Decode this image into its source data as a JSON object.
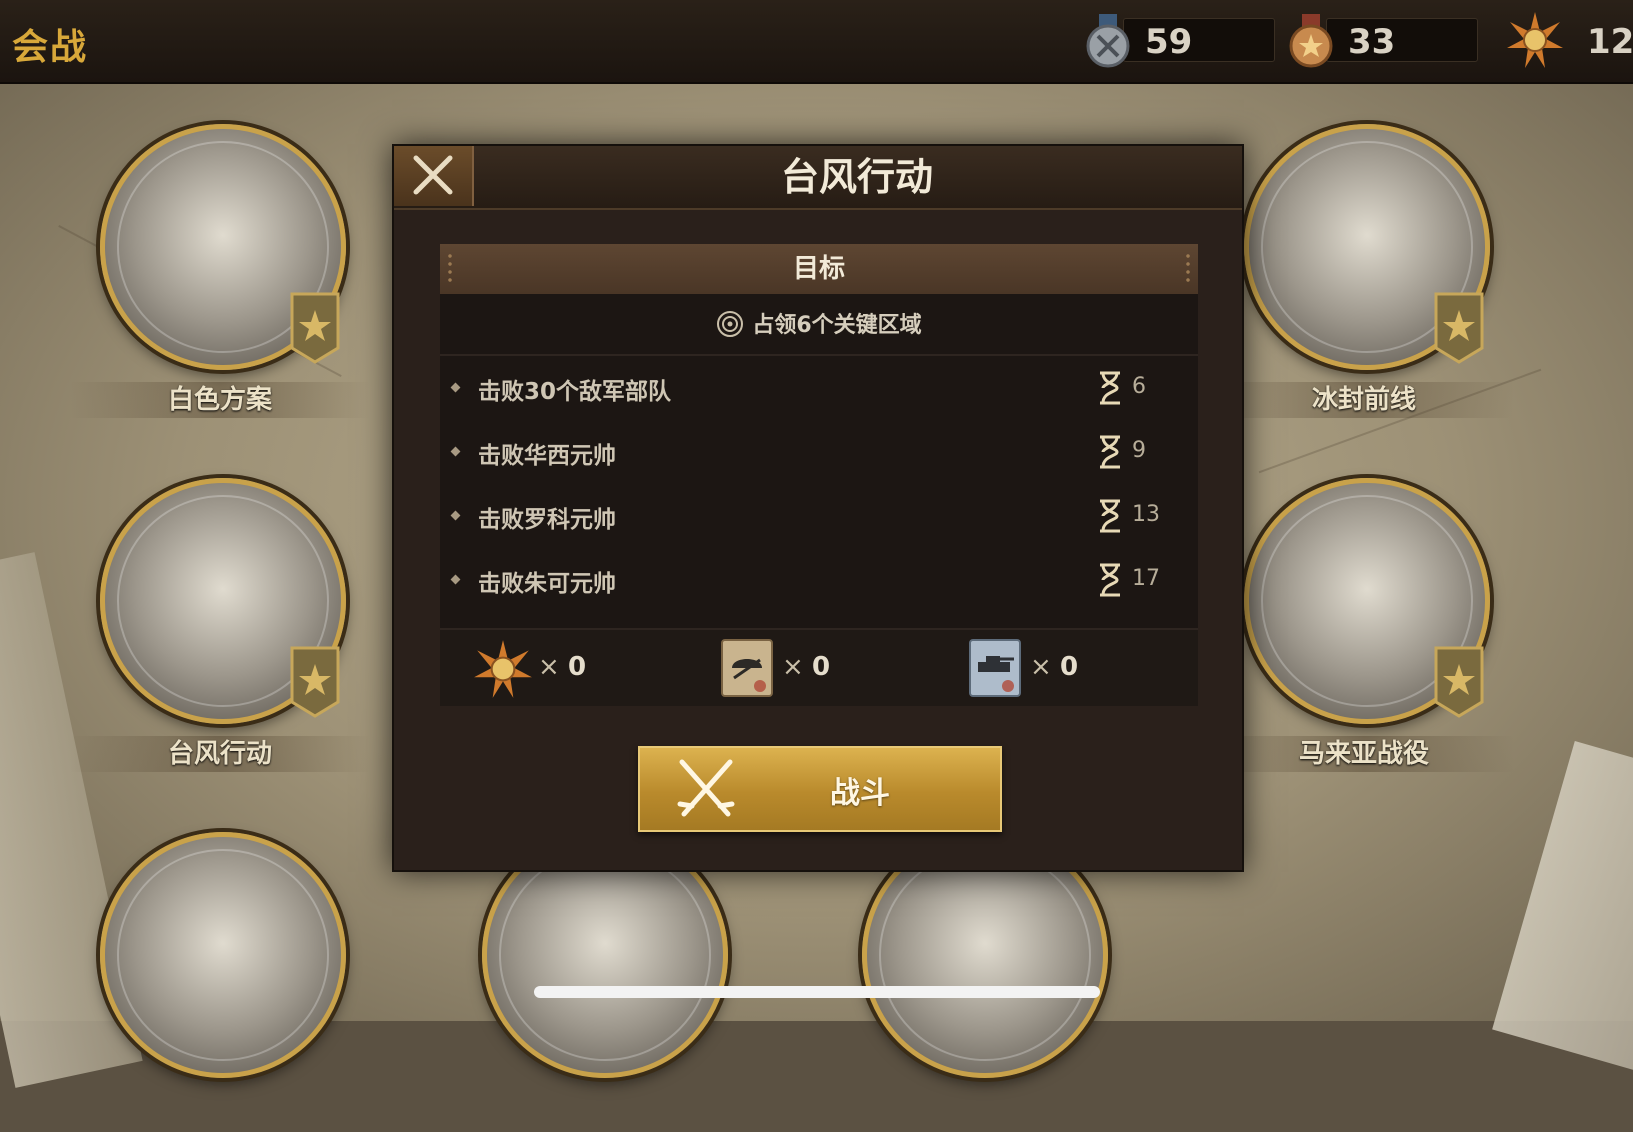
{
  "topbar": {
    "title": "会战",
    "resources": [
      {
        "icon": "silver-medal-icon",
        "value": "59"
      },
      {
        "icon": "bronze-medal-icon",
        "value": "33"
      },
      {
        "icon": "star-medal-icon",
        "value": "12"
      }
    ]
  },
  "campaigns": [
    {
      "label": "白色方案"
    },
    {
      "label": "冰封前线"
    },
    {
      "label": "台风行动"
    },
    {
      "label": "马来亚战役"
    }
  ],
  "modal": {
    "title": "台风行动",
    "goal_header": "目标",
    "primary_goal": "占领6个关键区域",
    "tasks": [
      {
        "text": "击败30个敌军部队",
        "turns": "6"
      },
      {
        "text": "击败华西元帅",
        "turns": "9"
      },
      {
        "text": "击败罗科元帅",
        "turns": "13"
      },
      {
        "text": "击败朱可元帅",
        "turns": "17"
      }
    ],
    "rewards": [
      {
        "icon": "star-medal-icon",
        "times": "×",
        "count": "0"
      },
      {
        "icon": "infantry-card-icon",
        "times": "×",
        "count": "0"
      },
      {
        "icon": "tank-card-icon",
        "times": "×",
        "count": "0"
      }
    ],
    "fight_label": "战斗"
  },
  "colors": {
    "accent_gold": "#d8a83a",
    "panel_dark": "#1c1613",
    "button_gold": "#c99a3a"
  }
}
